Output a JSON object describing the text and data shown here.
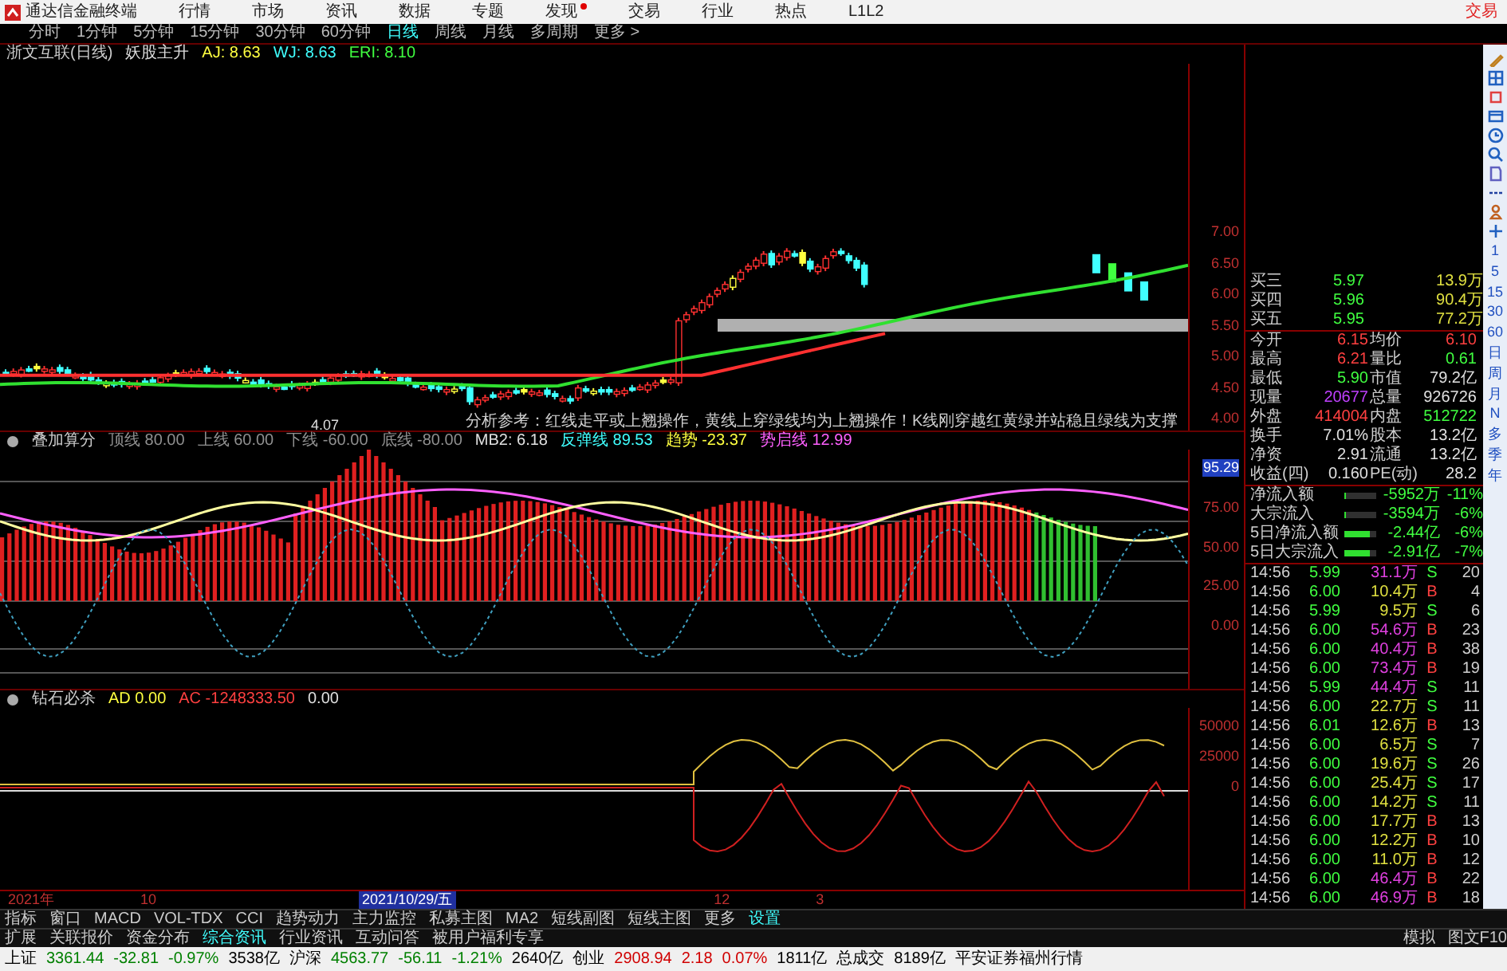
{
  "menu_bar": {
    "app_title": "通达信金融终端",
    "items": [
      {
        "label": "行情",
        "dot": false
      },
      {
        "label": "市场",
        "dot": false
      },
      {
        "label": "资讯",
        "dot": false
      },
      {
        "label": "数据",
        "dot": false
      },
      {
        "label": "专题",
        "dot": false
      },
      {
        "label": "发现",
        "dot": true
      },
      {
        "label": "交易",
        "dot": false
      },
      {
        "label": "行业",
        "dot": false
      },
      {
        "label": "热点",
        "dot": false
      },
      {
        "label": "L1L2",
        "dot": false
      }
    ],
    "right_label": "交易"
  },
  "period_tabs": [
    {
      "label": "分时",
      "selected": false
    },
    {
      "label": "1分钟",
      "selected": false
    },
    {
      "label": "5分钟",
      "selected": false
    },
    {
      "label": "15分钟",
      "selected": false
    },
    {
      "label": "30分钟",
      "selected": false
    },
    {
      "label": "60分钟",
      "selected": false
    },
    {
      "label": "日线",
      "selected": true
    },
    {
      "label": "周线",
      "selected": false
    },
    {
      "label": "月线",
      "selected": false
    },
    {
      "label": "多周期",
      "selected": false
    },
    {
      "label": "更多 >",
      "selected": false
    }
  ],
  "main_chart": {
    "title": "浙文互联(日线)",
    "indicator": "妖股主升",
    "values": [
      {
        "text": "AJ: 8.63",
        "color": "#ffff40"
      },
      {
        "text": "WJ: 8.63",
        "color": "#40ffff"
      },
      {
        "text": "ERI: 8.10",
        "color": "#40ff40"
      }
    ],
    "low_label": "4.07",
    "note": "分析参考：红线走平或上翘操作，黄线上穿绿线均为上翘操作！K线刚穿越红黄绿并站稳且绿线为支撑",
    "axis": [
      "7.00",
      "6.50",
      "6.00",
      "5.50",
      "5.00",
      "4.50",
      "4.00"
    ]
  },
  "sub_chart_1": {
    "title": "叠加算分",
    "values": [
      {
        "text": "顶线 80.00",
        "color": "#909090"
      },
      {
        "text": "上线 60.00",
        "color": "#909090"
      },
      {
        "text": "下线 -60.00",
        "color": "#909090"
      },
      {
        "text": "底线 -80.00",
        "color": "#909090"
      },
      {
        "text": "MB2: 6.18",
        "color": "#e0e0e0"
      },
      {
        "text": "反弹线 89.53",
        "color": "#40ffff"
      },
      {
        "text": "趋势 -23.37",
        "color": "#ffff40"
      },
      {
        "text": "势启线 12.99",
        "color": "#ff60ff"
      }
    ],
    "current": "95.29",
    "axis": [
      "75.00",
      "50.00",
      "25.00",
      "0.00"
    ]
  },
  "sub_chart_2": {
    "title": "钻石必杀",
    "values": [
      {
        "text": "AD 0.00",
        "color": "#ffff40"
      },
      {
        "text": "AC -1248333.50",
        "color": "#ff4040"
      },
      {
        "text": "0.00",
        "color": "#e0e0e0"
      }
    ],
    "axis": [
      "50000",
      "25000",
      "0"
    ]
  },
  "date_axis": [
    {
      "label": "2021年",
      "selected": false
    },
    {
      "label": "10",
      "selected": false
    },
    {
      "label": "2021/10/29/五",
      "selected": true
    },
    {
      "label": "12",
      "selected": false
    },
    {
      "label": "3",
      "selected": false
    }
  ],
  "quote_panel": {
    "bids": [
      {
        "label": "买三",
        "price": "5.97",
        "volume": "13.9万"
      },
      {
        "label": "买四",
        "price": "5.96",
        "volume": "90.4万"
      },
      {
        "label": "买五",
        "price": "5.95",
        "volume": "77.2万"
      }
    ],
    "stats": [
      [
        {
          "text": "今开"
        },
        {
          "text": "6.15",
          "color": "#ff4040"
        },
        {
          "text": "均价"
        },
        {
          "text": "6.10",
          "color": "#ff4040"
        }
      ],
      [
        {
          "text": "最高"
        },
        {
          "text": "6.21",
          "color": "#ff4040"
        },
        {
          "text": "量比"
        },
        {
          "text": "0.61",
          "color": "#40ff40"
        }
      ],
      [
        {
          "text": "最低"
        },
        {
          "text": "5.90",
          "color": "#40ff40"
        },
        {
          "text": "市值"
        },
        {
          "text": "79.2亿",
          "color": "#e0e0e0"
        }
      ],
      [
        {
          "text": "现量"
        },
        {
          "text": "20677",
          "color": "#c040ff"
        },
        {
          "text": "总量"
        },
        {
          "text": "926726",
          "color": "#e0e0e0"
        }
      ],
      [
        {
          "text": "外盘"
        },
        {
          "text": "414004",
          "color": "#ff4040"
        },
        {
          "text": "内盘"
        },
        {
          "text": "512722",
          "color": "#40ff40"
        }
      ],
      [
        {
          "text": "换手"
        },
        {
          "text": "7.01%",
          "color": "#e0e0e0"
        },
        {
          "text": "股本"
        },
        {
          "text": "13.2亿",
          "color": "#e0e0e0"
        }
      ],
      [
        {
          "text": "净资"
        },
        {
          "text": "2.91",
          "color": "#e0e0e0"
        },
        {
          "text": "流通"
        },
        {
          "text": "13.2亿",
          "color": "#e0e0e0"
        }
      ],
      [
        {
          "text": "收益(四)"
        },
        {
          "text": "0.160",
          "color": "#e0e0e0"
        },
        {
          "text": "PE(动)"
        },
        {
          "text": "28.2",
          "color": "#e0e0e0"
        }
      ]
    ],
    "flows": [
      {
        "label": "净流入额",
        "level": 0.05,
        "value": "-5952万",
        "percent": "-11%"
      },
      {
        "label": "大宗流入",
        "level": 0.05,
        "value": "-3594万",
        "percent": "-6%"
      },
      {
        "label": "5日净流入额",
        "level": 0.8,
        "value": "-2.44亿",
        "percent": "-6%"
      },
      {
        "label": "5日大宗流入",
        "level": 0.8,
        "value": "-2.91亿",
        "percent": "-7%"
      }
    ],
    "ticks": [
      {
        "time": "14:56",
        "price": "5.99",
        "volume": "31.1万",
        "color": "#e040e0",
        "side": "S",
        "kind": "sell",
        "count": "20"
      },
      {
        "time": "14:56",
        "price": "6.00",
        "volume": "10.4万",
        "color": "#e0e040",
        "side": "B",
        "kind": "buy",
        "count": "4"
      },
      {
        "time": "14:56",
        "price": "5.99",
        "volume": "9.5万",
        "color": "#e0e040",
        "side": "S",
        "kind": "sell",
        "count": "6"
      },
      {
        "time": "14:56",
        "price": "6.00",
        "volume": "54.6万",
        "color": "#e040e0",
        "side": "B",
        "kind": "buy",
        "count": "23"
      },
      {
        "time": "14:56",
        "price": "6.00",
        "volume": "40.4万",
        "color": "#e040e0",
        "side": "B",
        "kind": "buy",
        "count": "38"
      },
      {
        "time": "14:56",
        "price": "6.00",
        "volume": "73.4万",
        "color": "#e040e0",
        "side": "B",
        "kind": "buy",
        "count": "19"
      },
      {
        "time": "14:56",
        "price": "5.99",
        "volume": "44.4万",
        "color": "#e040e0",
        "side": "S",
        "kind": "sell",
        "count": "11"
      },
      {
        "time": "14:56",
        "price": "6.00",
        "volume": "22.7万",
        "color": "#e0e040",
        "side": "S",
        "kind": "sell",
        "count": "11"
      },
      {
        "time": "14:56",
        "price": "6.01",
        "volume": "12.6万",
        "color": "#e0e040",
        "side": "B",
        "kind": "buy",
        "count": "13"
      },
      {
        "time": "14:56",
        "price": "6.00",
        "volume": "6.5万",
        "color": "#e0e040",
        "side": "S",
        "kind": "sell",
        "count": "7"
      },
      {
        "time": "14:56",
        "price": "6.00",
        "volume": "19.6万",
        "color": "#e0e040",
        "side": "S",
        "kind": "sell",
        "count": "26"
      },
      {
        "time": "14:56",
        "price": "6.00",
        "volume": "25.4万",
        "color": "#e0e040",
        "side": "S",
        "kind": "sell",
        "count": "17"
      },
      {
        "time": "14:56",
        "price": "6.00",
        "volume": "14.2万",
        "color": "#e0e040",
        "side": "S",
        "kind": "sell",
        "count": "11"
      },
      {
        "time": "14:56",
        "price": "6.00",
        "volume": "17.7万",
        "color": "#e0e040",
        "side": "B",
        "kind": "buy",
        "count": "13"
      },
      {
        "time": "14:56",
        "price": "6.00",
        "volume": "12.2万",
        "color": "#e0e040",
        "side": "B",
        "kind": "buy",
        "count": "10"
      },
      {
        "time": "14:56",
        "price": "6.00",
        "volume": "11.0万",
        "color": "#e0e040",
        "side": "B",
        "kind": "buy",
        "count": "12"
      },
      {
        "time": "14:56",
        "price": "6.00",
        "volume": "46.4万",
        "color": "#e040e0",
        "side": "B",
        "kind": "buy",
        "count": "22"
      },
      {
        "time": "14:56",
        "price": "6.00",
        "volume": "46.9万",
        "color": "#e040e0",
        "side": "B",
        "kind": "buy",
        "count": "18"
      }
    ]
  },
  "side_toolbar": {
    "periods": [
      "1",
      "5",
      "15",
      "30",
      "60",
      "日",
      "周",
      "月",
      "N",
      "多",
      "季",
      "年"
    ]
  },
  "indicator_tabs": [
    {
      "label": "指标",
      "selected": false
    },
    {
      "label": "窗口",
      "selected": false
    },
    {
      "label": "MACD",
      "selected": false
    },
    {
      "label": "VOL-TDX",
      "selected": false
    },
    {
      "label": "CCI",
      "selected": false
    },
    {
      "label": "趋势动力",
      "selected": false
    },
    {
      "label": "主力监控",
      "selected": false
    },
    {
      "label": "私募主图",
      "selected": false
    },
    {
      "label": "MA2",
      "selected": false
    },
    {
      "label": "短线副图",
      "selected": false
    },
    {
      "label": "短线主图",
      "selected": false
    },
    {
      "label": "更多",
      "selected": false
    },
    {
      "label": "设置",
      "selected": true
    }
  ],
  "info_tabs": [
    {
      "label": "扩展",
      "selected": false
    },
    {
      "label": "关联报价",
      "selected": false
    },
    {
      "label": "资金分布",
      "selected": false
    },
    {
      "label": "综合资讯",
      "selected": true
    },
    {
      "label": "行业资讯",
      "selected": false
    },
    {
      "label": "互动问答",
      "selected": false
    },
    {
      "label": "被用户福利专享",
      "selected": false
    }
  ],
  "info_right": [
    "模拟",
    "图文F10"
  ],
  "status_bar": [
    {
      "text": "上证",
      "color": "#000000"
    },
    {
      "text": "3361.44",
      "color": "#008000"
    },
    {
      "text": "-32.81",
      "color": "#008000"
    },
    {
      "text": "-0.97%",
      "color": "#008000"
    },
    {
      "text": "3538亿",
      "color": "#000000"
    },
    {
      "text": "沪深",
      "color": "#000000"
    },
    {
      "text": "4563.77",
      "color": "#008000"
    },
    {
      "text": "-56.11",
      "color": "#008000"
    },
    {
      "text": "-1.21%",
      "color": "#008000"
    },
    {
      "text": "2640亿",
      "color": "#000000"
    },
    {
      "text": "创业",
      "color": "#000000"
    },
    {
      "text": "2908.94",
      "color": "#d00000"
    },
    {
      "text": "2.18",
      "color": "#d00000"
    },
    {
      "text": "0.07%",
      "color": "#d00000"
    },
    {
      "text": "1811亿",
      "color": "#000000"
    },
    {
      "text": "总成交",
      "color": "#000000"
    },
    {
      "text": "8189亿",
      "color": "#000000"
    },
    {
      "text": "平安证券福州行情",
      "color": "#000000"
    }
  ]
}
